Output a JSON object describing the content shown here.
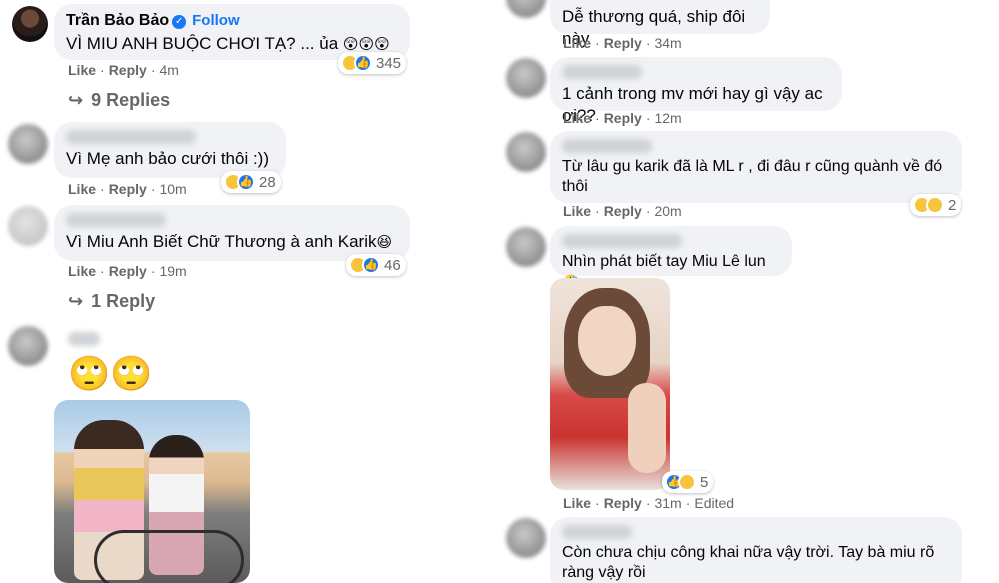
{
  "left": {
    "c1": {
      "name": "Trần Bảo Bảo",
      "follow": "Follow",
      "text": "VÌ MIU ANH BUỘC CHƠI TẠ? ... ủa",
      "emojis": "😲😲😲",
      "like": "Like",
      "reply": "Reply",
      "time": "4m",
      "react_count": "345",
      "replies": "9 Replies"
    },
    "c2": {
      "text": "Vì Mẹ anh bảo cưới thôi :))",
      "like": "Like",
      "reply": "Reply",
      "time": "10m",
      "react_count": "28"
    },
    "c3": {
      "text": "Vì Miu Anh Biết Chữ Thương à anh Karik",
      "emoji": "😆",
      "like": "Like",
      "reply": "Reply",
      "time": "19m",
      "react_count": "46",
      "replies": "1 Reply"
    },
    "c4": {
      "emojis": "🙄🙄"
    }
  },
  "right": {
    "c5": {
      "text": "Dễ thương quá, ship đôi này",
      "like": "Like",
      "reply": "Reply",
      "time": "34m"
    },
    "c6": {
      "text": "1 cảnh trong mv mới hay gì vậy ac ơi??",
      "like": "Like",
      "reply": "Reply",
      "time": "12m"
    },
    "c7": {
      "text": "Từ lâu gu karik đã là ML r , đi đâu r cũng quành về đó thôi",
      "like": "Like",
      "reply": "Reply",
      "time": "20m",
      "react_count": "2"
    },
    "c8": {
      "text": "Nhìn phát biết tay Miu Lê lun",
      "emoji": "🤣",
      "like": "Like",
      "reply": "Reply",
      "time": "31m",
      "edited": "Edited",
      "react_count": "5"
    },
    "c9": {
      "text": "Còn chưa chịu công khai nữa vậy trời. Tay bà miu rõ ràng vậy rồi"
    }
  },
  "icons": {
    "reply_arrow": "reply-arrow-icon",
    "verified": "verified-badge-icon"
  },
  "colors": {
    "bubble": "#f0f2f5",
    "accent": "#1877f2",
    "meta": "#65676b"
  }
}
